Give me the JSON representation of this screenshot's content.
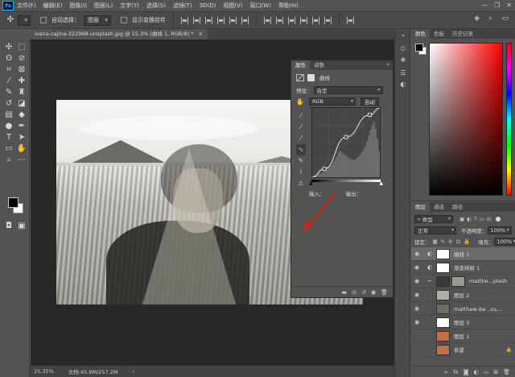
{
  "app": {
    "logo": "Ps"
  },
  "menu": [
    "文件(F)",
    "编辑(E)",
    "图像(I)",
    "图层(L)",
    "文字(Y)",
    "选择(S)",
    "滤镜(T)",
    "3D(D)",
    "视图(V)",
    "窗口(W)",
    "帮助(H)"
  ],
  "window_controls": {
    "minimize": "—",
    "restore": "❐",
    "close": "✕"
  },
  "options_bar": {
    "auto_select_label": "自动选择：",
    "auto_select_value": "图层",
    "show_transform_label": "显示变换控件"
  },
  "document": {
    "tab_title": "ivana-cajina-322968-unsplash.jpg @ 15.3% (曲线 1, RGB/8) *",
    "close_glyph": "×"
  },
  "properties": {
    "tabs": [
      "属性",
      "调整"
    ],
    "collapse_glyph": "«",
    "adj_title": "曲线",
    "preset_label": "预设：",
    "preset_value": "自定",
    "channel_value": "RGB",
    "auto_label": "自动",
    "input_label": "输入：",
    "output_label": "输出：",
    "curve_points": [
      [
        0,
        0
      ],
      [
        0.18,
        0.12
      ],
      [
        0.5,
        0.58
      ],
      [
        0.85,
        0.9
      ],
      [
        1,
        1
      ]
    ],
    "histogram": [
      2,
      3,
      3,
      4,
      5,
      6,
      8,
      9,
      11,
      14,
      16,
      18,
      22,
      26,
      30,
      35,
      38,
      36,
      34,
      32,
      30,
      28,
      27,
      26,
      25,
      26,
      28,
      30,
      33,
      36,
      40,
      45,
      52,
      60,
      68,
      75,
      80,
      70,
      55,
      38
    ],
    "footer_icons": [
      "clip-icon",
      "view-previous-icon",
      "reset-icon",
      "visibility-icon",
      "trash-icon"
    ]
  },
  "color_panel": {
    "tabs": [
      "颜色",
      "色板",
      "历史记录"
    ],
    "accent": "#ff0000"
  },
  "layers_panel": {
    "tabs": [
      "图层",
      "通道",
      "路径"
    ],
    "filter_label": "类型",
    "blend_mode": "正常",
    "opacity_label": "不透明度：",
    "opacity_value": "100%",
    "lock_label": "锁定：",
    "fill_label": "填充：",
    "fill_value": "100%",
    "layers": [
      {
        "name": "曲线 1",
        "visible": true,
        "adjustment": true,
        "thumb": "#ffffff",
        "selected": true,
        "linked": true
      },
      {
        "name": "渐变映射 1",
        "visible": true,
        "adjustment": true,
        "thumb": "#ffffff",
        "selected": false,
        "linked": true
      },
      {
        "name": "matthe...plash",
        "visible": true,
        "adjustment": false,
        "thumb": "#3a3a36",
        "selected": false,
        "linked": true,
        "mask": true
      },
      {
        "name": "图层 2",
        "visible": true,
        "adjustment": false,
        "thumb": "#b0b0a8",
        "selected": false,
        "linked": false
      },
      {
        "name": "matthew-be...nsplash 拷贝",
        "visible": true,
        "adjustment": false,
        "thumb": "#6d6d66",
        "selected": false,
        "linked": false
      },
      {
        "name": "图层 3",
        "visible": true,
        "adjustment": false,
        "thumb": "#ffffff",
        "selected": false,
        "linked": false
      },
      {
        "name": "图层 1",
        "visible": false,
        "adjustment": false,
        "thumb": "#c4703f",
        "selected": false,
        "linked": false
      },
      {
        "name": "背景",
        "visible": false,
        "adjustment": false,
        "thumb": "#c4703f",
        "selected": false,
        "linked": false,
        "locked": true
      }
    ],
    "footer_icons": [
      "link-icon",
      "fx",
      "mask-icon",
      "adjustment-icon",
      "group-icon",
      "new-layer-icon",
      "trash-icon"
    ]
  },
  "statusbar": {
    "zoom": "15.35%",
    "doc_info": "文档:45.9M/257.2M",
    "arrow": "›"
  }
}
